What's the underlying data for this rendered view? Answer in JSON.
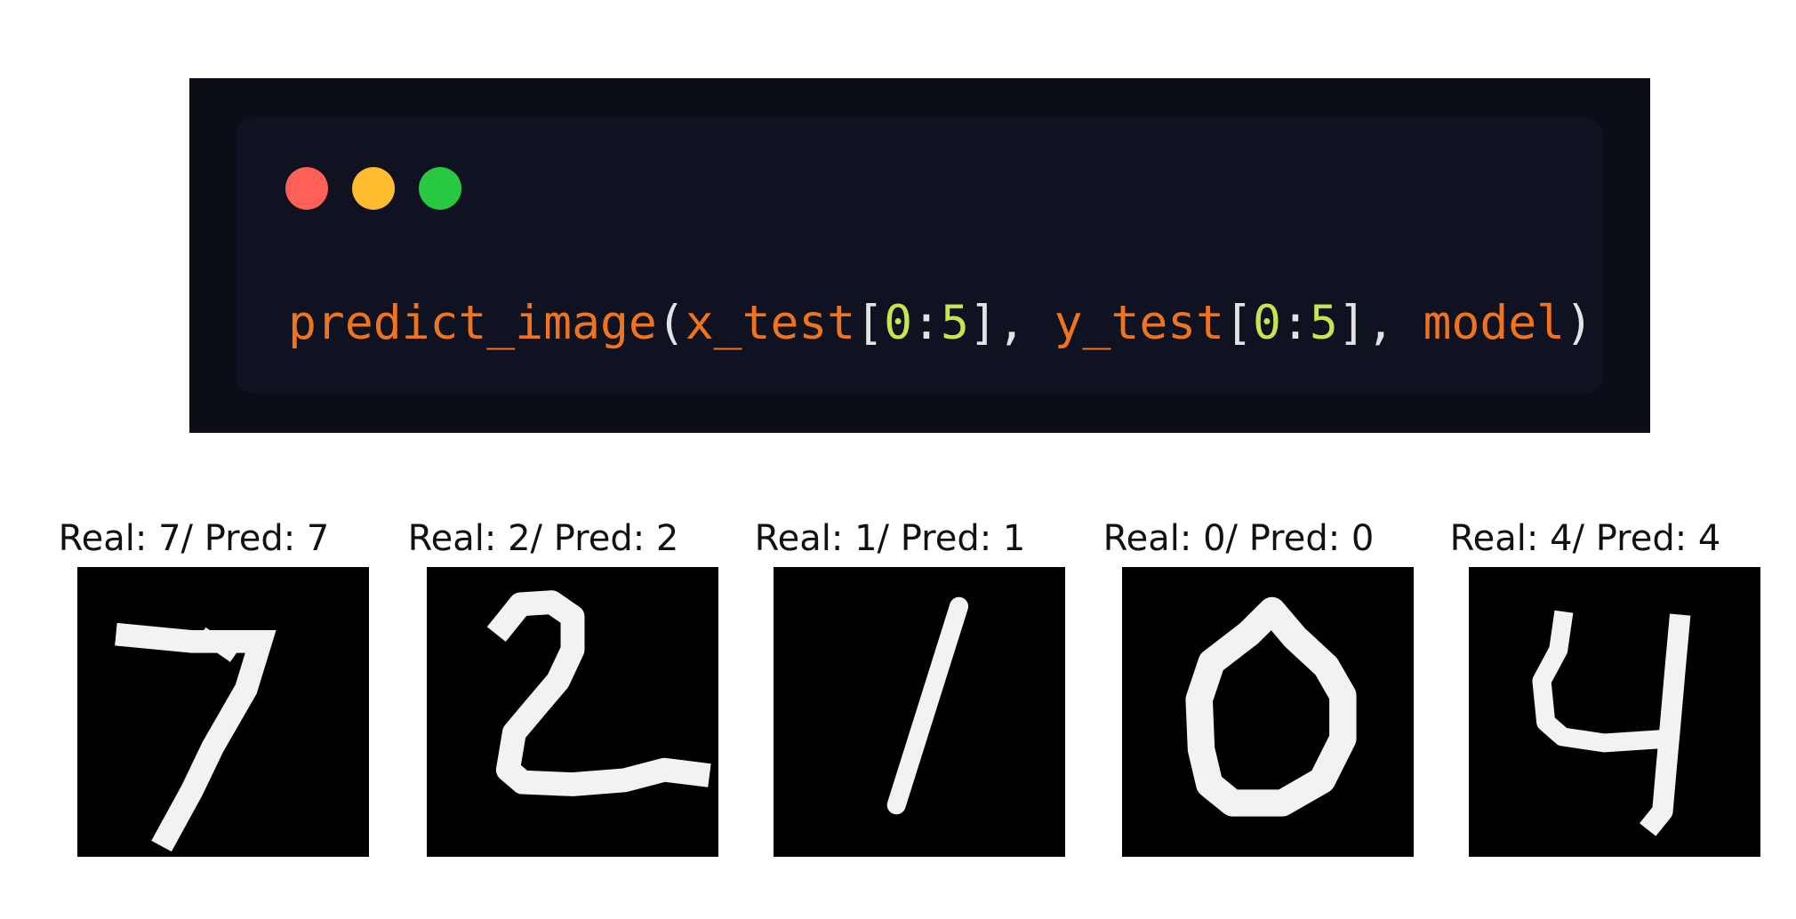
{
  "code_window": {
    "buttons": [
      {
        "name": "close",
        "color": "#ff5f57"
      },
      {
        "name": "minimize",
        "color": "#febc2e"
      },
      {
        "name": "maximize",
        "color": "#28c840"
      }
    ],
    "tokens": {
      "fn": "predict_image",
      "open_paren": "(",
      "arg1": "x_test",
      "open_br1": "[",
      "n1": "0",
      "colon1": ":",
      "n2": "5",
      "close_br1": "],",
      "space1": " ",
      "arg2": "y_test",
      "open_br2": "[",
      "n3": "0",
      "colon2": ":",
      "n4": "5",
      "close_br2": "],",
      "space2": " ",
      "arg3": "model",
      "close_paren": ")"
    },
    "colors": {
      "function_and_args": "#f0731e",
      "numbers": "#c6e64e",
      "punctuation": "#e3e3e3",
      "background": "#0b0e17"
    }
  },
  "predictions": [
    {
      "title": "Real: 7/ Pred: 7",
      "real": 7,
      "pred": 7,
      "digit_icon": "digit-7-image"
    },
    {
      "title": "Real: 2/ Pred: 2",
      "real": 2,
      "pred": 2,
      "digit_icon": "digit-2-image"
    },
    {
      "title": "Real: 1/ Pred: 1",
      "real": 1,
      "pred": 1,
      "digit_icon": "digit-1-image"
    },
    {
      "title": "Real: 0/ Pred: 0",
      "real": 0,
      "pred": 0,
      "digit_icon": "digit-0-image"
    },
    {
      "title": "Real: 4/ Pred: 4",
      "real": 4,
      "pred": 4,
      "digit_icon": "digit-4-image"
    }
  ]
}
